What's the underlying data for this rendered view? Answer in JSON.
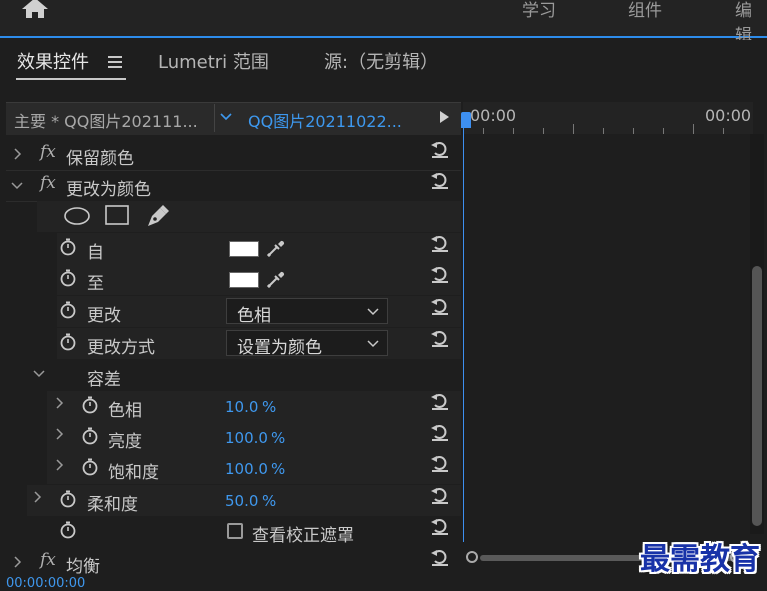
{
  "workspace_tabs": [
    "学习",
    "组件",
    "编辑"
  ],
  "panel_tabs": {
    "effect_controls": "效果控件",
    "lumetri_scope": "Lumetri 范围",
    "source": "源:（无剪辑）"
  },
  "clip_header": {
    "master_clip": "主要 * QQ图片202111...",
    "sequence_clip": "QQ图片20211022..."
  },
  "timeline": {
    "time_start": "00:00",
    "time_end": "00:00"
  },
  "effects": {
    "preserve_color": {
      "fx": "fx",
      "label": "保留颜色"
    },
    "change_to_color": {
      "fx": "fx",
      "label": "更改为颜色",
      "from_label": "自",
      "from_color": "#ffffff",
      "to_label": "至",
      "to_color": "#ffffff",
      "change_label": "更改",
      "change_value": "色相",
      "change_by_label": "更改方式",
      "change_by_value": "设置为颜色",
      "tolerance_label": "容差",
      "hue_label": "色相",
      "hue_value": "10.0",
      "hue_unit": "%",
      "lightness_label": "亮度",
      "lightness_value": "100.0",
      "lightness_unit": "%",
      "saturation_label": "饱和度",
      "saturation_value": "100.0",
      "saturation_unit": "%",
      "softness_label": "柔和度",
      "softness_value": "50.0",
      "softness_unit": "%",
      "view_mask_label": "查看校正遮罩"
    },
    "equalize": {
      "fx": "fx",
      "label": "均衡"
    }
  },
  "timecode": "00:00:00:00",
  "watermark": "最需教育",
  "colors": {
    "accent": "#3d8ff0",
    "value_blue": "#3f98ee",
    "panel_bg": "#1e1e1e"
  }
}
